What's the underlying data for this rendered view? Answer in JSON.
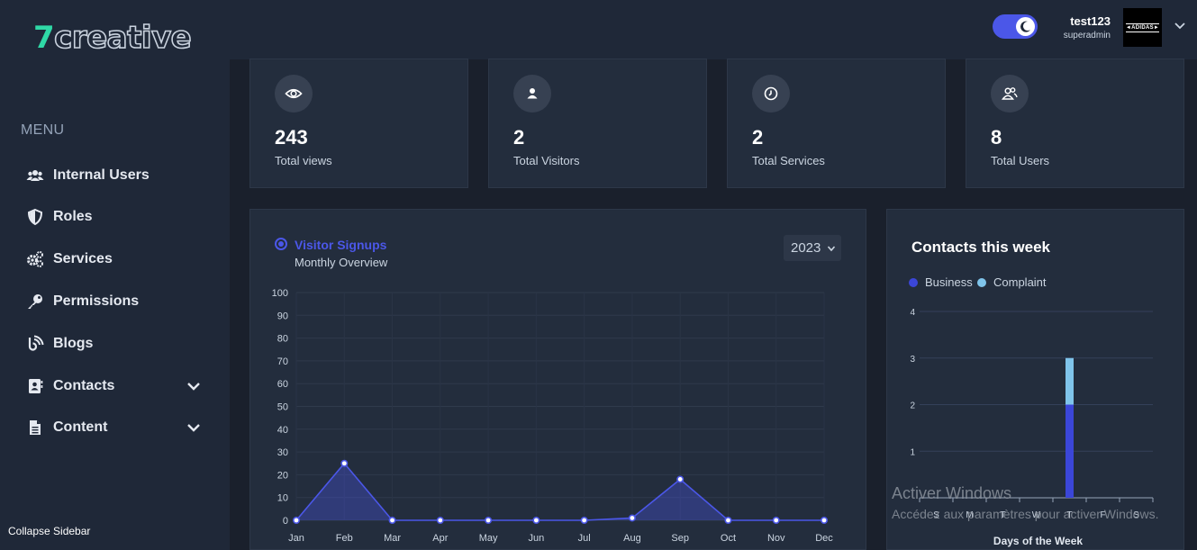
{
  "header": {
    "logo_number": "7",
    "logo_word": "creative",
    "user_name": "test123",
    "user_role": "superadmin",
    "avatar_text": "◄ADIDAS►"
  },
  "sidebar": {
    "menu_title": "MENU",
    "items": [
      {
        "label": "Internal Users",
        "icon": "users-icon"
      },
      {
        "label": "Roles",
        "icon": "shield-icon"
      },
      {
        "label": "Services",
        "icon": "cogs-icon"
      },
      {
        "label": "Permissions",
        "icon": "key-icon"
      },
      {
        "label": "Blogs",
        "icon": "blog-icon"
      },
      {
        "label": "Contacts",
        "icon": "address-book-icon",
        "has_submenu": true
      },
      {
        "label": "Content",
        "icon": "file-icon",
        "has_submenu": true
      }
    ],
    "collapse_label": "Collapse Sidebar"
  },
  "stats": [
    {
      "value": "243",
      "label": "Total views",
      "icon": "eye-icon"
    },
    {
      "value": "2",
      "label": "Total Visitors",
      "icon": "user-icon"
    },
    {
      "value": "2",
      "label": "Total Services",
      "icon": "history-icon"
    },
    {
      "value": "8",
      "label": "Total Users",
      "icon": "users-icon"
    }
  ],
  "visitor_chart": {
    "title": "Visitor Signups",
    "subtitle": "Monthly Overview",
    "year": "2023"
  },
  "contacts_chart": {
    "title": "Contacts this week"
  },
  "chart_data": [
    {
      "type": "area",
      "categories": [
        "Jan",
        "Feb",
        "Mar",
        "Apr",
        "May",
        "Jun",
        "Jul",
        "Aug",
        "Sep",
        "Oct",
        "Nov",
        "Dec"
      ],
      "series": [
        {
          "values": [
            0,
            25,
            0,
            0,
            0,
            0,
            0,
            1,
            18,
            0,
            0,
            0
          ]
        }
      ],
      "ylim": [
        0,
        100
      ],
      "yticks": [
        0,
        10,
        20,
        30,
        40,
        50,
        60,
        70,
        80,
        90,
        100
      ],
      "grid": true,
      "color": "#4b57e8"
    },
    {
      "type": "bar",
      "stacked": true,
      "categories": [
        "S",
        "M",
        "T",
        "W",
        "T",
        "F",
        "S"
      ],
      "series": [
        {
          "name": "Business",
          "values": [
            0,
            0,
            0,
            0,
            2,
            0,
            0
          ],
          "color": "#3b46d8"
        },
        {
          "name": "Complaint",
          "values": [
            0,
            0,
            0,
            0,
            1,
            0,
            0
          ],
          "color": "#7fc4ea"
        }
      ],
      "ylim": [
        0,
        4
      ],
      "yticks": [
        1,
        2,
        3,
        4
      ],
      "xlabel": "Days of the Week",
      "legend": "top-left",
      "grid": true
    }
  ],
  "watermark": {
    "line1": "Activer Windows",
    "line2": "Accédez aux paramètres pour activer Windows."
  }
}
